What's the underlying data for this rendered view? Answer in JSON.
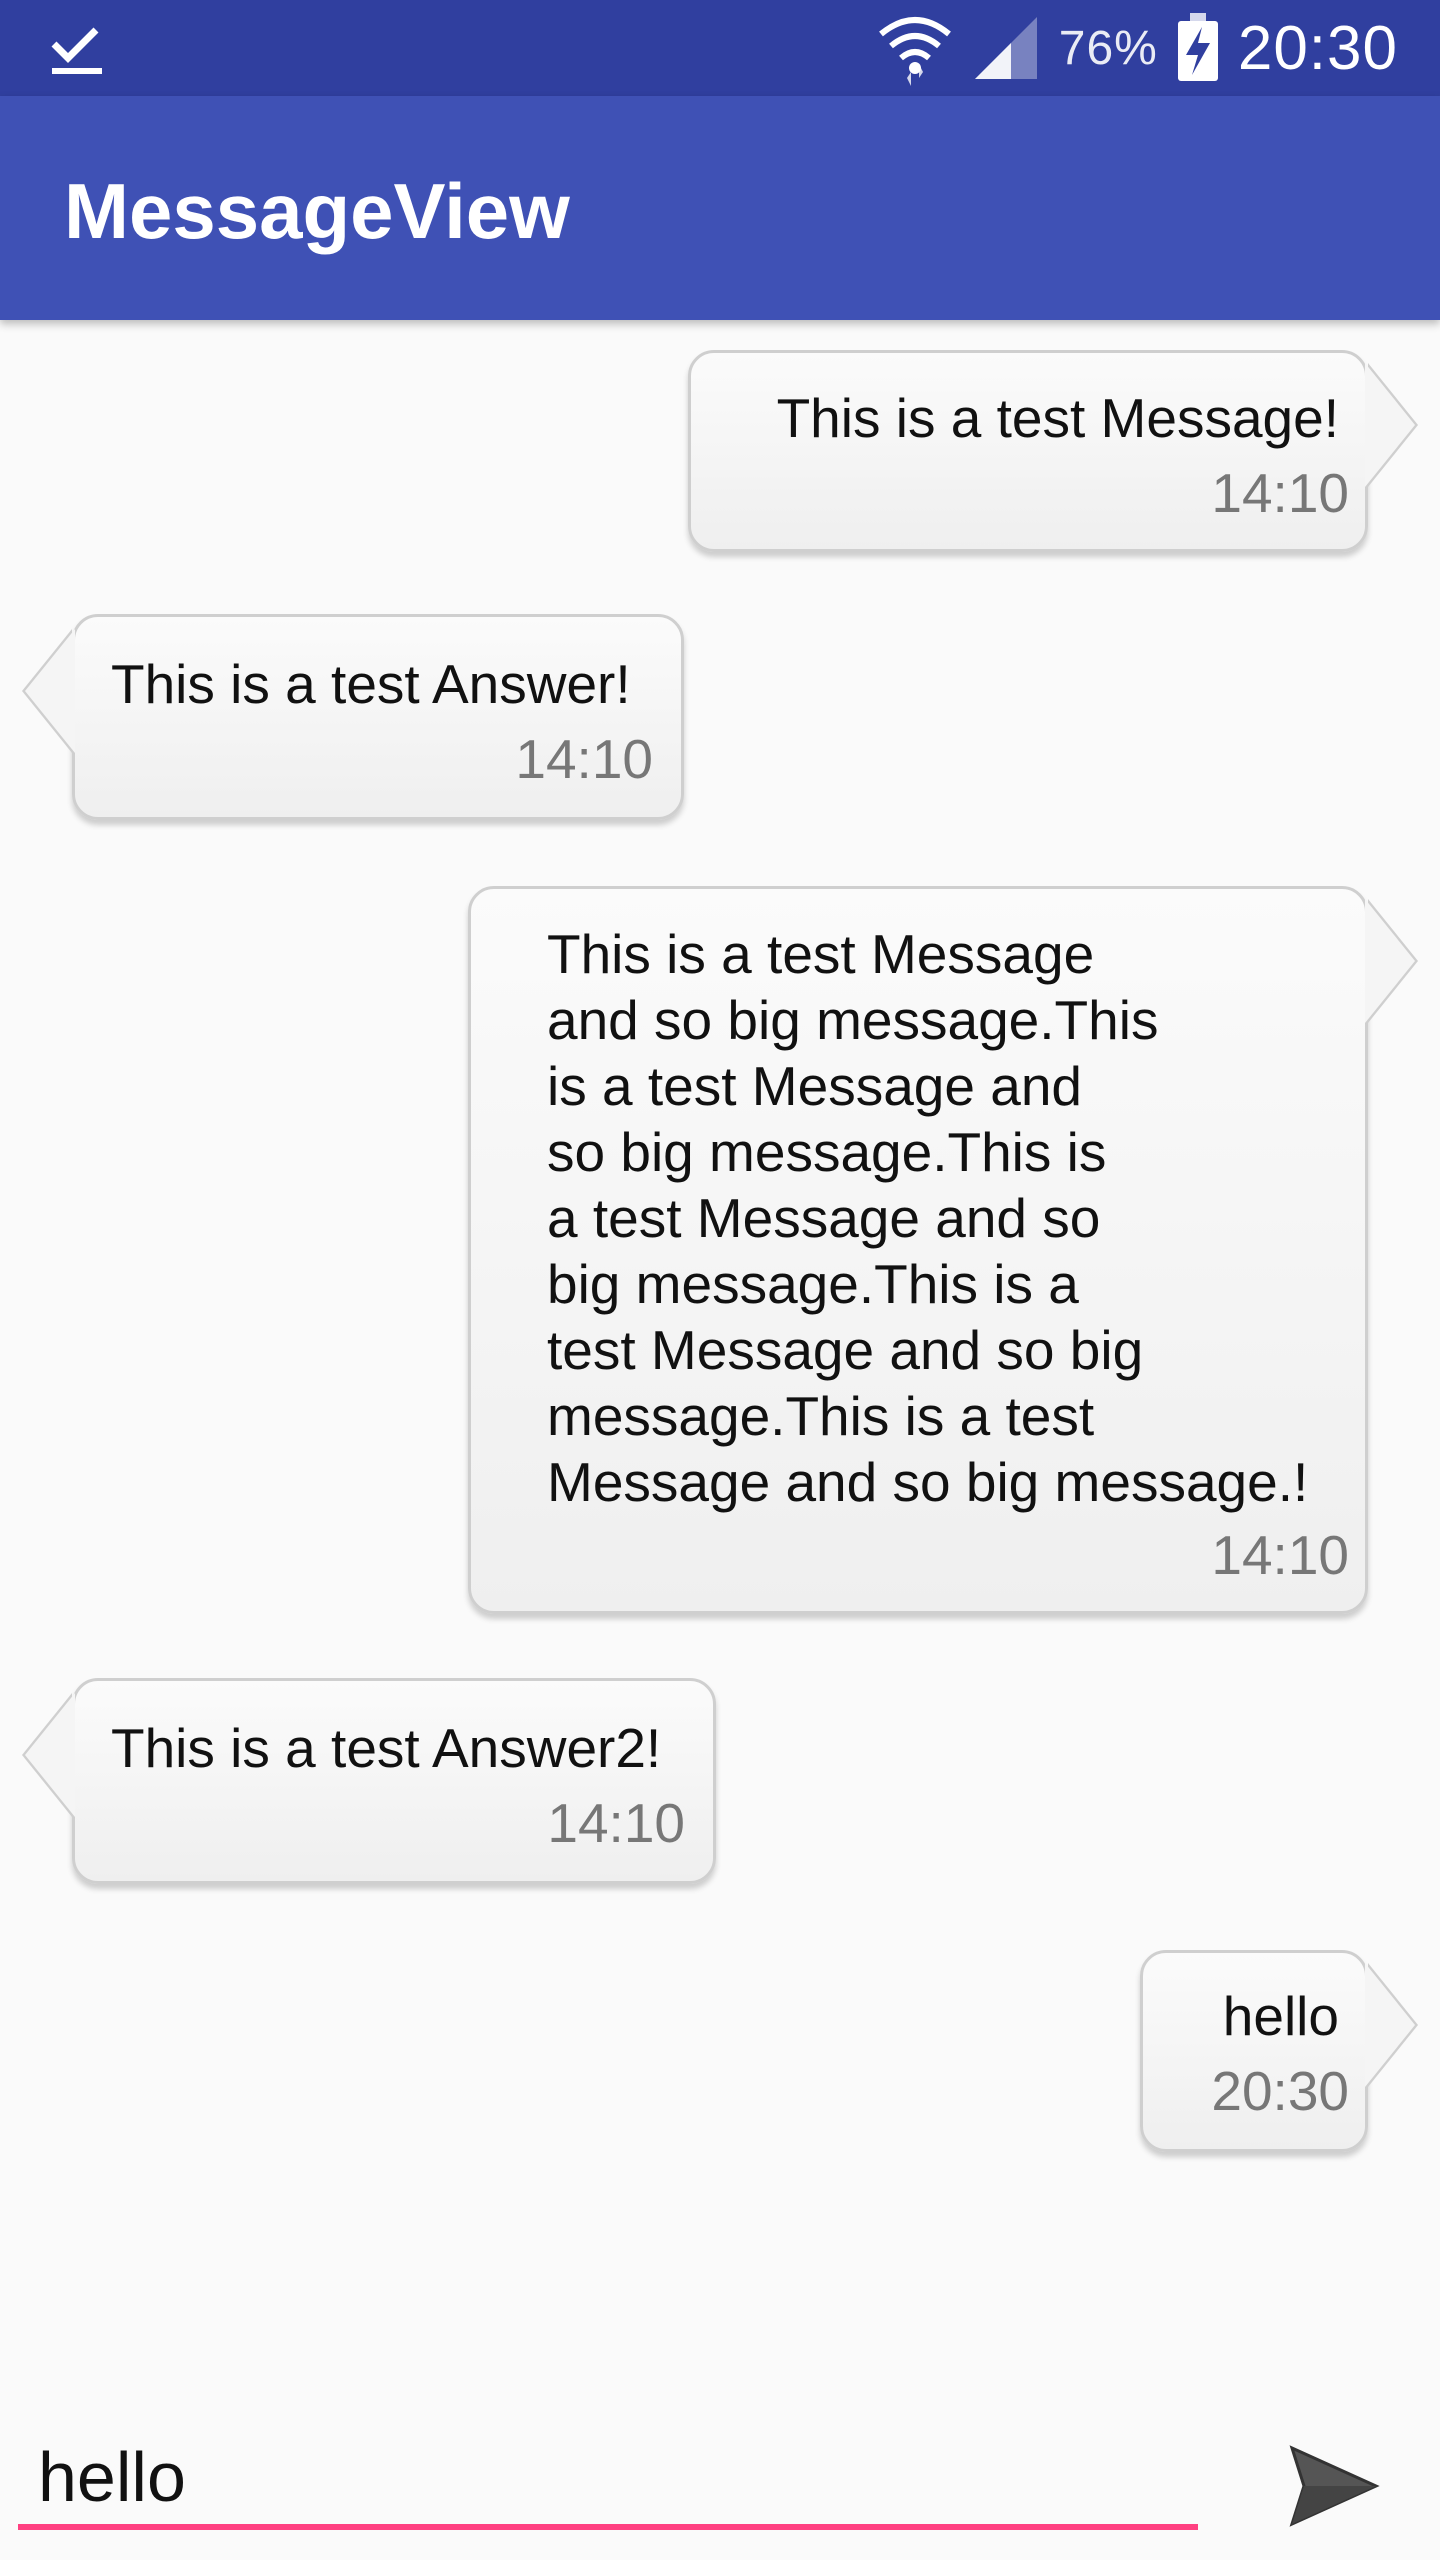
{
  "status_bar": {
    "left_icon": "download-done-icon",
    "wifi_icon": "wifi-icon",
    "signal_icon": "cell-signal-icon",
    "battery_percent": "76%",
    "battery_icon": "battery-charging-icon",
    "time": "20:30"
  },
  "app_bar": {
    "title": "MessageView"
  },
  "messages": [
    {
      "direction": "outgoing",
      "text": "This is a test Message!",
      "time": "14:10"
    },
    {
      "direction": "incoming",
      "text": "This is a test Answer!",
      "time": "14:10"
    },
    {
      "direction": "outgoing",
      "text": "This is a test Message\nand so big message.This\nis a test Message and\nso big message.This is\na test Message and so\nbig message.This is a\ntest Message and so big\nmessage.This is a test\nMessage and so big message.!",
      "time": "14:10"
    },
    {
      "direction": "incoming",
      "text": "This is a test Answer2!",
      "time": "14:10"
    },
    {
      "direction": "outgoing",
      "text": "hello",
      "time": "20:30"
    }
  ],
  "composer": {
    "input_value": "hello",
    "send_icon": "send-icon"
  },
  "colors": {
    "status_bar": "#303f9f",
    "app_bar": "#3f51b5",
    "accent": "#ff4081"
  }
}
